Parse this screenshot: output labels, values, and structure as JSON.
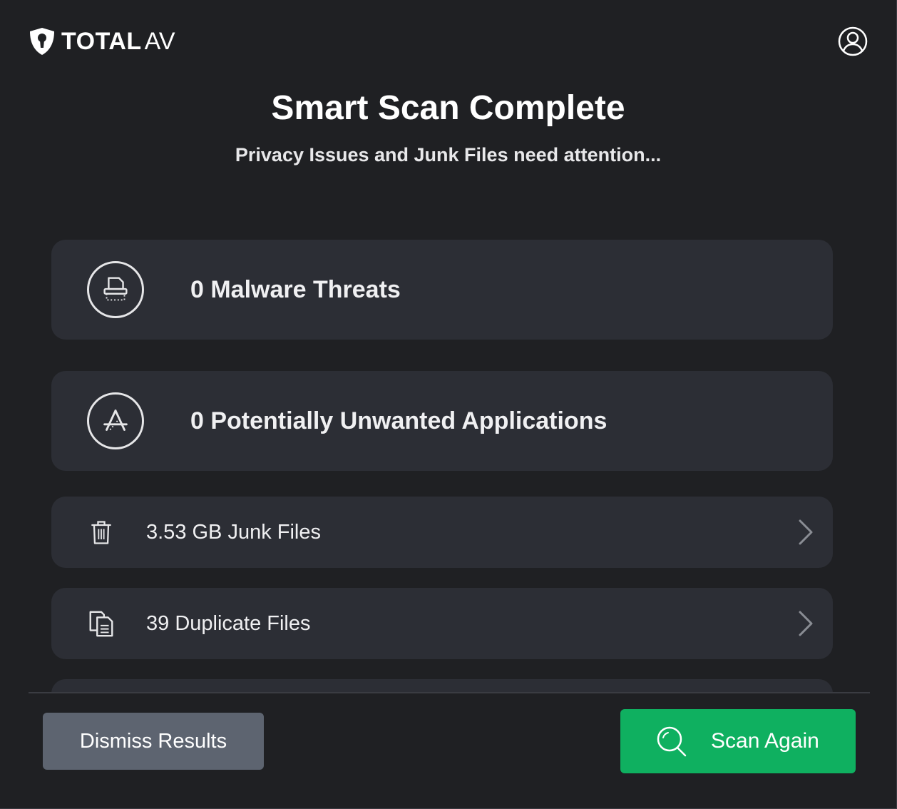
{
  "header": {
    "logo_bold": "TOTAL",
    "logo_light": "AV",
    "account_icon": "user-circle-icon"
  },
  "scan": {
    "title": "Smart Scan Complete",
    "subtitle": "Privacy Issues and Junk Files need attention..."
  },
  "results": [
    {
      "label": "0 Malware Threats",
      "icon": "malware-shredder-icon"
    },
    {
      "label": "0 Potentially Unwanted Applications",
      "icon": "app-store-icon"
    },
    {
      "label": "3.53 GB Junk Files",
      "icon": "trash-icon"
    },
    {
      "label": "39 Duplicate Files",
      "icon": "duplicate-files-icon"
    }
  ],
  "actions": {
    "dismiss_label": "Dismiss Results",
    "scan_again_label": "Scan Again"
  },
  "colors": {
    "background": "#1f2023",
    "card": "#2c2e35",
    "primary_green": "#0fb060",
    "dismiss_gray": "#5d6470"
  }
}
